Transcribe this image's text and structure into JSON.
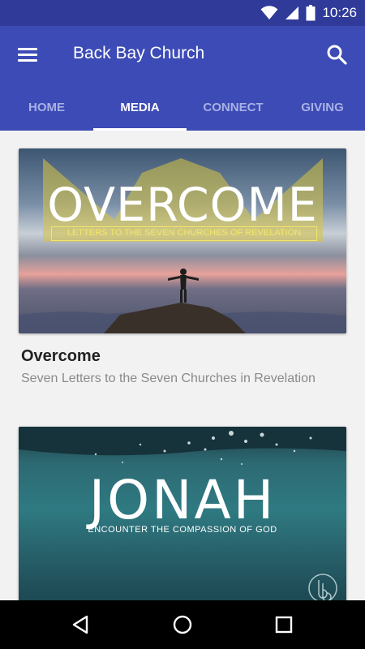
{
  "status_bar": {
    "time": "10:26",
    "icons": [
      "wifi-icon",
      "signal-icon",
      "battery-icon"
    ]
  },
  "app_bar": {
    "title": "Back Bay Church",
    "menu_icon": "menu-icon",
    "search_icon": "search-icon"
  },
  "tabs": [
    {
      "label": "HOME",
      "active": false
    },
    {
      "label": "MEDIA",
      "active": true
    },
    {
      "label": "CONNECT",
      "active": false
    },
    {
      "label": "GIVING",
      "active": false
    }
  ],
  "cards": [
    {
      "image_title": "OVERCOME",
      "image_subtitle": "LETTERS TO THE SEVEN CHURCHES OF REVELATION",
      "title": "Overcome",
      "subtitle": "Seven Letters to the Seven Churches in Revelation"
    },
    {
      "image_title": "JONAH",
      "image_subtitle": "ENCOUNTER THE COMPASSION OF GOD"
    }
  ],
  "colors": {
    "status_bar": "#2f3a99",
    "app_bar": "#3c4bb5",
    "tab_inactive": "#a9b1e4",
    "background": "#f2f2f2"
  },
  "nav_bar": {
    "icons": [
      "back-icon",
      "home-icon",
      "recents-icon"
    ]
  }
}
